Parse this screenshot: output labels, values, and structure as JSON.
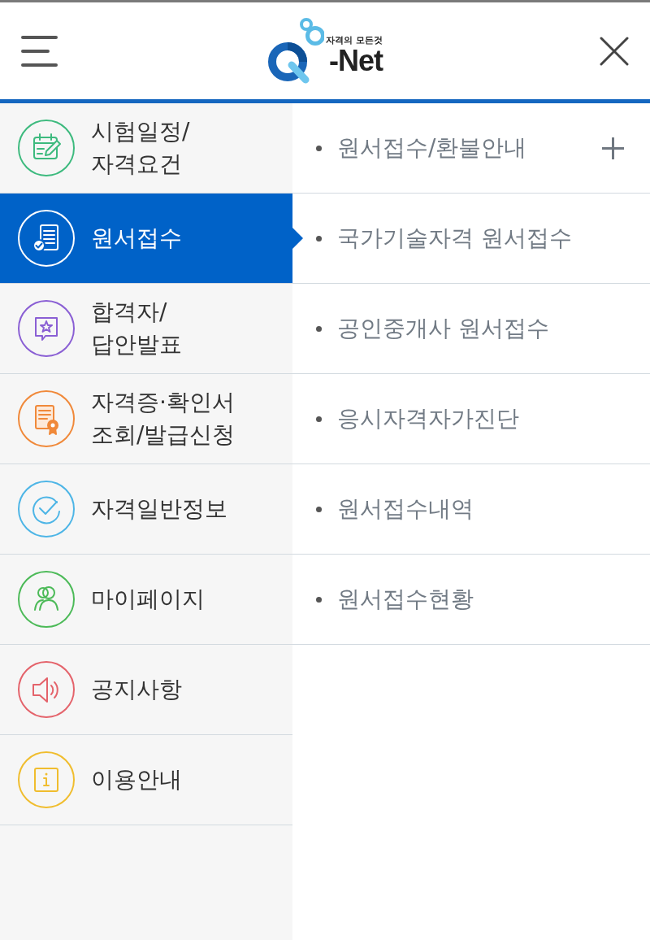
{
  "header": {
    "logo": {
      "tagline": "자격의 모든것",
      "wordmark": "-Net"
    }
  },
  "categories": [
    {
      "kind": "calendar",
      "label": "시험일정/\n자격요건",
      "selected": false
    },
    {
      "kind": "application",
      "label": "원서접수",
      "selected": true
    },
    {
      "kind": "announcement",
      "label": "합격자/\n답안발표",
      "selected": false
    },
    {
      "kind": "certificate",
      "label": "자격증·확인서\n조회/발급신청",
      "selected": false
    },
    {
      "kind": "check",
      "label": "자격일반정보",
      "selected": false
    },
    {
      "kind": "people",
      "label": "마이페이지",
      "selected": false
    },
    {
      "kind": "speaker",
      "label": "공지사항",
      "selected": false
    },
    {
      "kind": "info",
      "label": "이용안내",
      "selected": false
    }
  ],
  "submenu": [
    {
      "label": "원서접수/환불안내",
      "expandable": true
    },
    {
      "label": "국가기술자격 원서접수",
      "expandable": false
    },
    {
      "label": "공인중개사 원서접수",
      "expandable": false
    },
    {
      "label": "응시자격자가진단",
      "expandable": false
    },
    {
      "label": "원서접수내역",
      "expandable": false
    },
    {
      "label": "원서접수현황",
      "expandable": false
    }
  ]
}
